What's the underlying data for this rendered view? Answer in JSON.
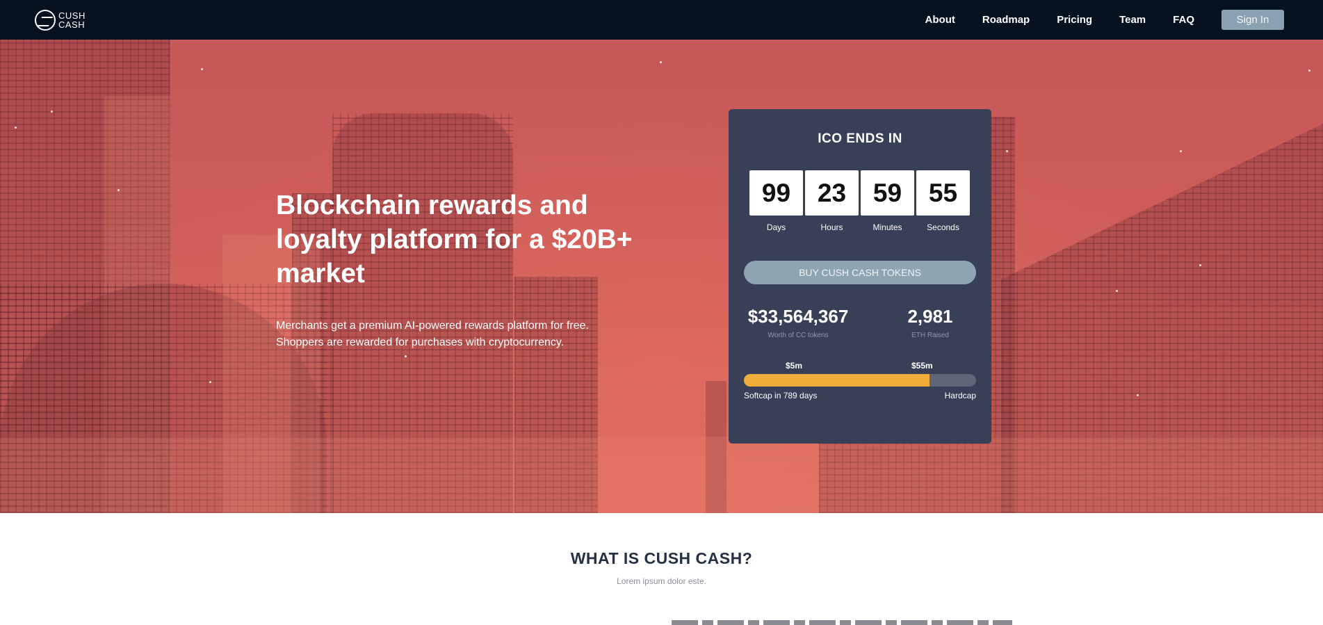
{
  "nav": {
    "logo": {
      "line1": "CUSH",
      "line2": "CASH"
    },
    "links": [
      "About",
      "Roadmap",
      "Pricing",
      "Team",
      "FAQ"
    ],
    "signin_label": "Sign In"
  },
  "hero": {
    "title": "Blockchain rewards and loyalty platform for a $20B+ market",
    "subtitle_line1": "Merchants get a premium AI-powered rewards platform for free.",
    "subtitle_line2": "Shoppers are rewarded for purchases with cryptocurrency."
  },
  "ico": {
    "title": "ICO ENDS IN",
    "countdown": [
      {
        "value": "99",
        "label": "Days"
      },
      {
        "value": "23",
        "label": "Hours"
      },
      {
        "value": "59",
        "label": "Minutes"
      },
      {
        "value": "55",
        "label": "Seconds"
      }
    ],
    "buy_label": "BUY CUSH CASH TOKENS",
    "stats": [
      {
        "value": "$33,564,367",
        "label": "Worth of CC tokens"
      },
      {
        "value": "2,981",
        "label": "ETH Raised"
      }
    ],
    "softcap_label": "$5m",
    "hardcap_label": "$55m",
    "progress_fraction": 0.8,
    "progress_color": "#f1ad3a",
    "softcap_text": "Softcap in 789 days",
    "hardcap_text": "Hardcap"
  },
  "what": {
    "title": "WHAT IS CUSH CASH?",
    "subtitle": "Lorem ipsum dolor este."
  },
  "colors": {
    "nav_bg": "#06121f",
    "hero_red": "#d05e5a",
    "card_bg": "#374056",
    "button_gray": "#8ea4b3"
  }
}
